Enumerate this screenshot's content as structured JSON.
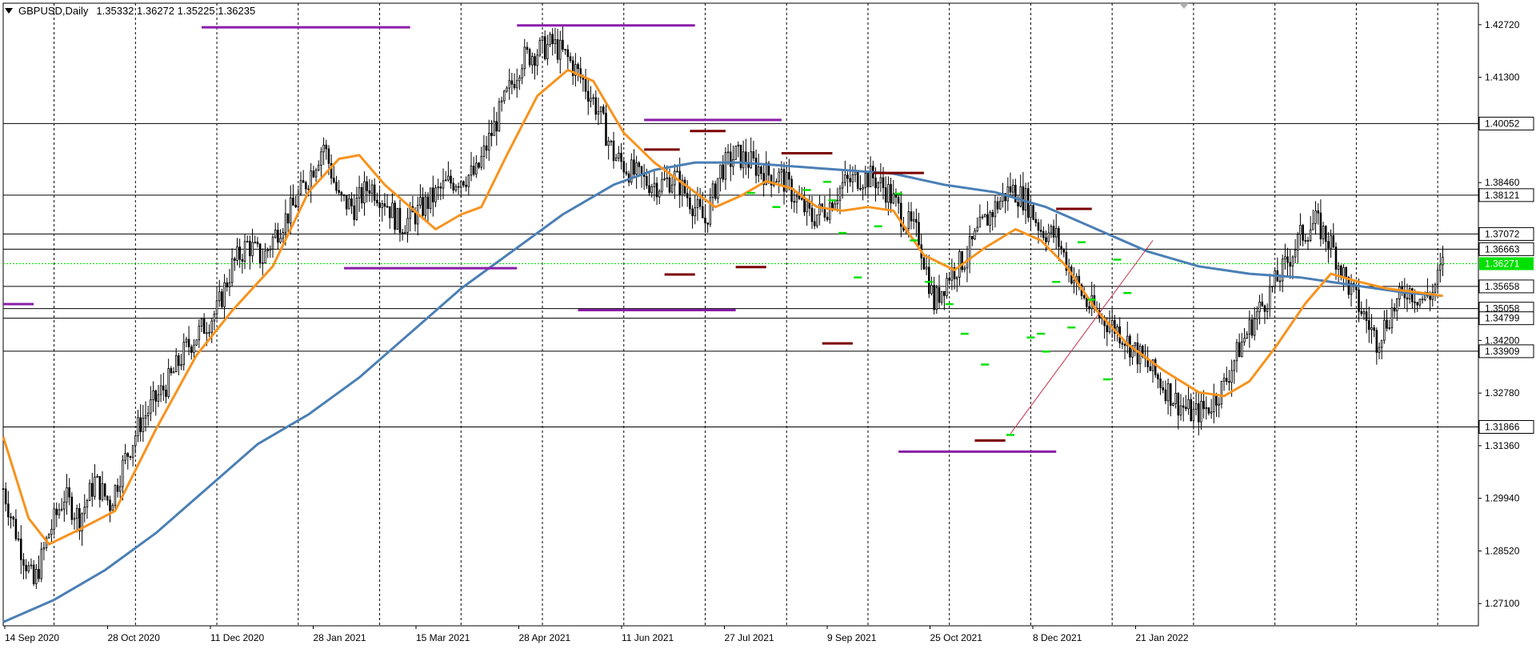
{
  "header": {
    "symbol": "GBPUSD,Daily",
    "ohlc": "1.35332 1.36272 1.35225 1.36235"
  },
  "colors": {
    "background": "#ffffff",
    "grid": "#000000",
    "candle": "#000000",
    "ma_fast": "#f7931e",
    "ma_slow": "#4a7fb5",
    "resistance_marker": "#7b0000",
    "support_marker": "#8a1ea8",
    "fractal": "#00e000",
    "current_price_bg": "#00e000",
    "trendline": "#c0304a"
  },
  "chart_data": {
    "type": "candlestick",
    "symbol": "GBPUSD",
    "timeframe": "Daily",
    "ylim": [
      1.265,
      1.433
    ],
    "x_ticks": [
      "14 Sep 2020",
      "28 Oct 2020",
      "11 Dec 2020",
      "28 Jan 2021",
      "15 Mar 2021",
      "28 Apr 2021",
      "11 Jun 2021",
      "27 Jul 2021",
      "9 Sep 2021",
      "25 Oct 2021",
      "8 Dec 2021",
      "21 Jan 2022"
    ],
    "y_ticks": [
      "1.42720",
      "1.41300",
      "1.38460",
      "1.34200",
      "1.32780",
      "1.31360",
      "1.29940",
      "1.28520",
      "1.27100"
    ],
    "level_labels": [
      {
        "price": 1.40052,
        "label": "1.40052"
      },
      {
        "price": 1.38121,
        "label": "1.38121"
      },
      {
        "price": 1.37072,
        "label": "1.37072"
      },
      {
        "price": 1.36663,
        "label": "1.36663"
      },
      {
        "price": 1.35658,
        "label": "1.35658"
      },
      {
        "price": 1.35058,
        "label": "1.35058"
      },
      {
        "price": 1.34799,
        "label": "1.34799"
      },
      {
        "price": 1.33909,
        "label": "1.33909"
      },
      {
        "price": 1.31866,
        "label": "1.31866"
      }
    ],
    "current_price": {
      "price": 1.36271,
      "label": "1.36271"
    },
    "close_path": [
      {
        "x": 0,
        "y": 1.302
      },
      {
        "x": 6,
        "y": 1.288
      },
      {
        "x": 12,
        "y": 1.276
      },
      {
        "x": 18,
        "y": 1.29
      },
      {
        "x": 24,
        "y": 1.3
      },
      {
        "x": 30,
        "y": 1.294
      },
      {
        "x": 36,
        "y": 1.304
      },
      {
        "x": 42,
        "y": 1.298
      },
      {
        "x": 48,
        "y": 1.31
      },
      {
        "x": 54,
        "y": 1.32
      },
      {
        "x": 60,
        "y": 1.326
      },
      {
        "x": 66,
        "y": 1.332
      },
      {
        "x": 72,
        "y": 1.34
      },
      {
        "x": 78,
        "y": 1.345
      },
      {
        "x": 84,
        "y": 1.35
      },
      {
        "x": 90,
        "y": 1.362
      },
      {
        "x": 96,
        "y": 1.368
      },
      {
        "x": 102,
        "y": 1.364
      },
      {
        "x": 108,
        "y": 1.372
      },
      {
        "x": 114,
        "y": 1.378
      },
      {
        "x": 120,
        "y": 1.386
      },
      {
        "x": 126,
        "y": 1.395
      },
      {
        "x": 132,
        "y": 1.38
      },
      {
        "x": 138,
        "y": 1.378
      },
      {
        "x": 144,
        "y": 1.384
      },
      {
        "x": 150,
        "y": 1.38
      },
      {
        "x": 156,
        "y": 1.373
      },
      {
        "x": 162,
        "y": 1.376
      },
      {
        "x": 168,
        "y": 1.38
      },
      {
        "x": 174,
        "y": 1.384
      },
      {
        "x": 180,
        "y": 1.386
      },
      {
        "x": 186,
        "y": 1.387
      },
      {
        "x": 192,
        "y": 1.398
      },
      {
        "x": 198,
        "y": 1.408
      },
      {
        "x": 204,
        "y": 1.418
      },
      {
        "x": 210,
        "y": 1.42
      },
      {
        "x": 216,
        "y": 1.422
      },
      {
        "x": 222,
        "y": 1.418
      },
      {
        "x": 228,
        "y": 1.412
      },
      {
        "x": 234,
        "y": 1.404
      },
      {
        "x": 240,
        "y": 1.392
      },
      {
        "x": 246,
        "y": 1.388
      },
      {
        "x": 252,
        "y": 1.385
      },
      {
        "x": 258,
        "y": 1.384
      },
      {
        "x": 264,
        "y": 1.386
      },
      {
        "x": 270,
        "y": 1.38
      },
      {
        "x": 276,
        "y": 1.374
      },
      {
        "x": 282,
        "y": 1.388
      },
      {
        "x": 288,
        "y": 1.392
      },
      {
        "x": 294,
        "y": 1.39
      },
      {
        "x": 300,
        "y": 1.387
      },
      {
        "x": 306,
        "y": 1.386
      },
      {
        "x": 312,
        "y": 1.38
      },
      {
        "x": 318,
        "y": 1.375
      },
      {
        "x": 324,
        "y": 1.378
      },
      {
        "x": 330,
        "y": 1.384
      },
      {
        "x": 336,
        "y": 1.386
      },
      {
        "x": 342,
        "y": 1.386
      },
      {
        "x": 348,
        "y": 1.382
      },
      {
        "x": 354,
        "y": 1.375
      },
      {
        "x": 360,
        "y": 1.37
      },
      {
        "x": 366,
        "y": 1.352
      },
      {
        "x": 372,
        "y": 1.36
      },
      {
        "x": 378,
        "y": 1.364
      },
      {
        "x": 384,
        "y": 1.372
      },
      {
        "x": 390,
        "y": 1.378
      },
      {
        "x": 396,
        "y": 1.383
      },
      {
        "x": 402,
        "y": 1.38
      },
      {
        "x": 408,
        "y": 1.372
      },
      {
        "x": 414,
        "y": 1.37
      },
      {
        "x": 420,
        "y": 1.36
      },
      {
        "x": 426,
        "y": 1.352
      },
      {
        "x": 432,
        "y": 1.348
      },
      {
        "x": 438,
        "y": 1.345
      },
      {
        "x": 444,
        "y": 1.34
      },
      {
        "x": 450,
        "y": 1.335
      },
      {
        "x": 456,
        "y": 1.33
      },
      {
        "x": 462,
        "y": 1.325
      },
      {
        "x": 468,
        "y": 1.322
      },
      {
        "x": 474,
        "y": 1.324
      },
      {
        "x": 480,
        "y": 1.33
      },
      {
        "x": 486,
        "y": 1.34
      },
      {
        "x": 492,
        "y": 1.348
      },
      {
        "x": 498,
        "y": 1.355
      },
      {
        "x": 504,
        "y": 1.362
      },
      {
        "x": 510,
        "y": 1.37
      },
      {
        "x": 516,
        "y": 1.374
      },
      {
        "x": 522,
        "y": 1.368
      },
      {
        "x": 528,
        "y": 1.358
      },
      {
        "x": 534,
        "y": 1.35
      },
      {
        "x": 540,
        "y": 1.342
      },
      {
        "x": 546,
        "y": 1.35
      },
      {
        "x": 552,
        "y": 1.356
      },
      {
        "x": 558,
        "y": 1.353
      },
      {
        "x": 562,
        "y": 1.355
      },
      {
        "x": 566,
        "y": 1.3624
      }
    ],
    "ma_fast": [
      {
        "x": 0,
        "y": 1.316
      },
      {
        "x": 10,
        "y": 1.294
      },
      {
        "x": 18,
        "y": 1.287
      },
      {
        "x": 30,
        "y": 1.291
      },
      {
        "x": 44,
        "y": 1.296
      },
      {
        "x": 60,
        "y": 1.318
      },
      {
        "x": 76,
        "y": 1.338
      },
      {
        "x": 90,
        "y": 1.35
      },
      {
        "x": 106,
        "y": 1.362
      },
      {
        "x": 120,
        "y": 1.382
      },
      {
        "x": 132,
        "y": 1.391
      },
      {
        "x": 140,
        "y": 1.392
      },
      {
        "x": 150,
        "y": 1.384
      },
      {
        "x": 160,
        "y": 1.378
      },
      {
        "x": 170,
        "y": 1.372
      },
      {
        "x": 180,
        "y": 1.376
      },
      {
        "x": 188,
        "y": 1.378
      },
      {
        "x": 198,
        "y": 1.392
      },
      {
        "x": 210,
        "y": 1.408
      },
      {
        "x": 222,
        "y": 1.415
      },
      {
        "x": 232,
        "y": 1.412
      },
      {
        "x": 244,
        "y": 1.398
      },
      {
        "x": 256,
        "y": 1.39
      },
      {
        "x": 268,
        "y": 1.384
      },
      {
        "x": 280,
        "y": 1.378
      },
      {
        "x": 290,
        "y": 1.381
      },
      {
        "x": 300,
        "y": 1.385
      },
      {
        "x": 310,
        "y": 1.383
      },
      {
        "x": 320,
        "y": 1.378
      },
      {
        "x": 330,
        "y": 1.377
      },
      {
        "x": 340,
        "y": 1.378
      },
      {
        "x": 350,
        "y": 1.377
      },
      {
        "x": 362,
        "y": 1.365
      },
      {
        "x": 374,
        "y": 1.361
      },
      {
        "x": 386,
        "y": 1.367
      },
      {
        "x": 398,
        "y": 1.372
      },
      {
        "x": 408,
        "y": 1.369
      },
      {
        "x": 418,
        "y": 1.362
      },
      {
        "x": 430,
        "y": 1.35
      },
      {
        "x": 442,
        "y": 1.341
      },
      {
        "x": 456,
        "y": 1.334
      },
      {
        "x": 470,
        "y": 1.328
      },
      {
        "x": 480,
        "y": 1.327
      },
      {
        "x": 490,
        "y": 1.331
      },
      {
        "x": 500,
        "y": 1.34
      },
      {
        "x": 512,
        "y": 1.352
      },
      {
        "x": 522,
        "y": 1.36
      },
      {
        "x": 532,
        "y": 1.358
      },
      {
        "x": 544,
        "y": 1.356
      },
      {
        "x": 556,
        "y": 1.355
      },
      {
        "x": 566,
        "y": 1.354
      }
    ],
    "ma_slow": [
      {
        "x": 0,
        "y": 1.266
      },
      {
        "x": 20,
        "y": 1.272
      },
      {
        "x": 40,
        "y": 1.28
      },
      {
        "x": 60,
        "y": 1.29
      },
      {
        "x": 80,
        "y": 1.302
      },
      {
        "x": 100,
        "y": 1.314
      },
      {
        "x": 120,
        "y": 1.322
      },
      {
        "x": 140,
        "y": 1.332
      },
      {
        "x": 160,
        "y": 1.344
      },
      {
        "x": 180,
        "y": 1.356
      },
      {
        "x": 200,
        "y": 1.366
      },
      {
        "x": 220,
        "y": 1.376
      },
      {
        "x": 240,
        "y": 1.384
      },
      {
        "x": 256,
        "y": 1.388
      },
      {
        "x": 272,
        "y": 1.39
      },
      {
        "x": 290,
        "y": 1.39
      },
      {
        "x": 310,
        "y": 1.389
      },
      {
        "x": 330,
        "y": 1.388
      },
      {
        "x": 350,
        "y": 1.387
      },
      {
        "x": 370,
        "y": 1.384
      },
      {
        "x": 390,
        "y": 1.382
      },
      {
        "x": 410,
        "y": 1.378
      },
      {
        "x": 430,
        "y": 1.372
      },
      {
        "x": 450,
        "y": 1.366
      },
      {
        "x": 470,
        "y": 1.362
      },
      {
        "x": 490,
        "y": 1.36
      },
      {
        "x": 510,
        "y": 1.359
      },
      {
        "x": 530,
        "y": 1.357
      },
      {
        "x": 550,
        "y": 1.355
      },
      {
        "x": 566,
        "y": 1.354
      }
    ],
    "resistance_markers": [
      {
        "x0": 252,
        "x1": 266,
        "price": 1.3935
      },
      {
        "x0": 270,
        "x1": 284,
        "price": 1.3985
      },
      {
        "x0": 306,
        "x1": 326,
        "price": 1.3925
      },
      {
        "x0": 342,
        "x1": 362,
        "price": 1.3872
      },
      {
        "x0": 414,
        "x1": 428,
        "price": 1.3775
      },
      {
        "x0": 260,
        "x1": 272,
        "price": 1.3598
      },
      {
        "x0": 288,
        "x1": 300,
        "price": 1.3618
      },
      {
        "x0": 322,
        "x1": 334,
        "price": 1.3412
      },
      {
        "x0": 382,
        "x1": 394,
        "price": 1.315
      }
    ],
    "support_markers": [
      {
        "x0": 0,
        "x1": 12,
        "price": 1.3518
      },
      {
        "x0": 78,
        "x1": 160,
        "price": 1.4265
      },
      {
        "x0": 202,
        "x1": 272,
        "price": 1.427
      },
      {
        "x0": 252,
        "x1": 306,
        "price": 1.4015
      },
      {
        "x0": 134,
        "x1": 202,
        "price": 1.3615
      },
      {
        "x0": 226,
        "x1": 288,
        "price": 1.3502
      },
      {
        "x0": 352,
        "x1": 414,
        "price": 1.312
      }
    ],
    "fractals": [
      {
        "x": 294,
        "price": 1.3818
      },
      {
        "x": 304,
        "price": 1.378
      },
      {
        "x": 316,
        "price": 1.3826
      },
      {
        "x": 324,
        "price": 1.3848
      },
      {
        "x": 326,
        "price": 1.3798
      },
      {
        "x": 330,
        "price": 1.371
      },
      {
        "x": 336,
        "price": 1.359
      },
      {
        "x": 344,
        "price": 1.3728
      },
      {
        "x": 352,
        "price": 1.3816
      },
      {
        "x": 358,
        "price": 1.369
      },
      {
        "x": 364,
        "price": 1.3578
      },
      {
        "x": 372,
        "price": 1.3518
      },
      {
        "x": 378,
        "price": 1.3438
      },
      {
        "x": 386,
        "price": 1.3355
      },
      {
        "x": 396,
        "price": 1.3165
      },
      {
        "x": 404,
        "price": 1.3428
      },
      {
        "x": 408,
        "price": 1.3438
      },
      {
        "x": 410,
        "price": 1.339
      },
      {
        "x": 414,
        "price": 1.3578
      },
      {
        "x": 420,
        "price": 1.3455
      },
      {
        "x": 424,
        "price": 1.3685
      },
      {
        "x": 428,
        "price": 1.353
      },
      {
        "x": 434,
        "price": 1.3315
      },
      {
        "x": 438,
        "price": 1.3638
      },
      {
        "x": 442,
        "price": 1.3548
      }
    ],
    "trendline": {
      "x0": 396,
      "p0": 1.3168,
      "x1": 452,
      "p1": 1.369
    }
  },
  "bottom_bar": {
    "labels": [
      "14 Sep 2020",
      "28 Oct 2020",
      "11 Dec 2020",
      "28 Jan 2021",
      "15 Mar 2021",
      "28 Apr 2021",
      "11 Jun 2021",
      "27 Jul 2021",
      "9 Sep 2021",
      "25 Oct 2021",
      "8 Dec 2021",
      "21 Jan 2022"
    ]
  }
}
